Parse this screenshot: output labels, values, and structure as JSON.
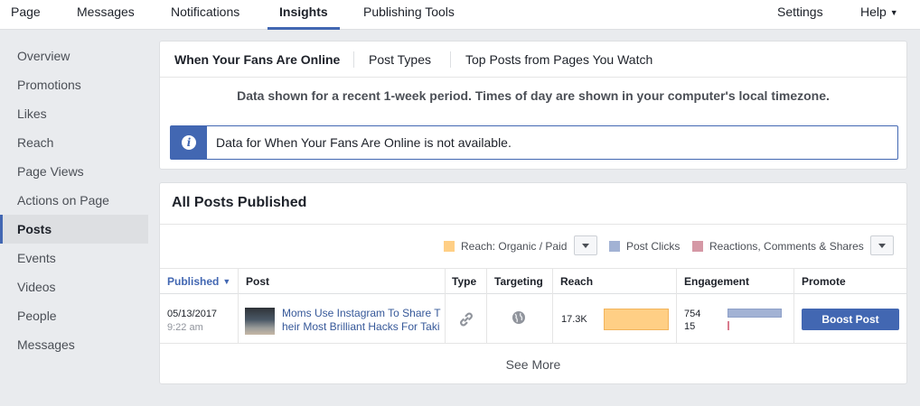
{
  "nav": {
    "page": "Page",
    "messages": "Messages",
    "notifications": "Notifications",
    "insights": "Insights",
    "publishing_tools": "Publishing Tools",
    "settings": "Settings",
    "help": "Help"
  },
  "sidebar": {
    "items": [
      {
        "label": "Overview"
      },
      {
        "label": "Promotions"
      },
      {
        "label": "Likes"
      },
      {
        "label": "Reach"
      },
      {
        "label": "Page Views"
      },
      {
        "label": "Actions on Page"
      },
      {
        "label": "Posts"
      },
      {
        "label": "Events"
      },
      {
        "label": "Videos"
      },
      {
        "label": "People"
      },
      {
        "label": "Messages"
      }
    ],
    "active": "Posts"
  },
  "fans_panel": {
    "tabs": [
      "When Your Fans Are Online",
      "Post Types",
      "Top Posts from Pages You Watch"
    ],
    "info": "Data shown for a recent 1-week period. Times of day are shown in your computer's local timezone.",
    "notice": "Data for When Your Fans Are Online is not available."
  },
  "posts_panel": {
    "title": "All Posts Published",
    "legend": [
      {
        "label": "Reach: Organic / Paid",
        "color": "#ffcf85"
      },
      {
        "label": "Post Clicks",
        "color": "#a2b2d4"
      },
      {
        "label": "Reactions, Comments & Shares",
        "color": "#d598a5"
      }
    ],
    "columns": {
      "published": "Published",
      "post": "Post",
      "type": "Type",
      "targeting": "Targeting",
      "reach": "Reach",
      "engagement": "Engagement",
      "promote": "Promote"
    },
    "rows": [
      {
        "date": "05/13/2017",
        "time": "9:22 am",
        "post_line1": "Moms Use Instagram To Share T",
        "post_line2": "heir Most Brilliant Hacks For Taki",
        "reach": "17.3K",
        "post_clicks": "754",
        "reactions": "15",
        "boost_label": "Boost Post",
        "type_icon": "link-icon",
        "targeting_icon": "globe-icon"
      }
    ],
    "see_more": "See More"
  }
}
